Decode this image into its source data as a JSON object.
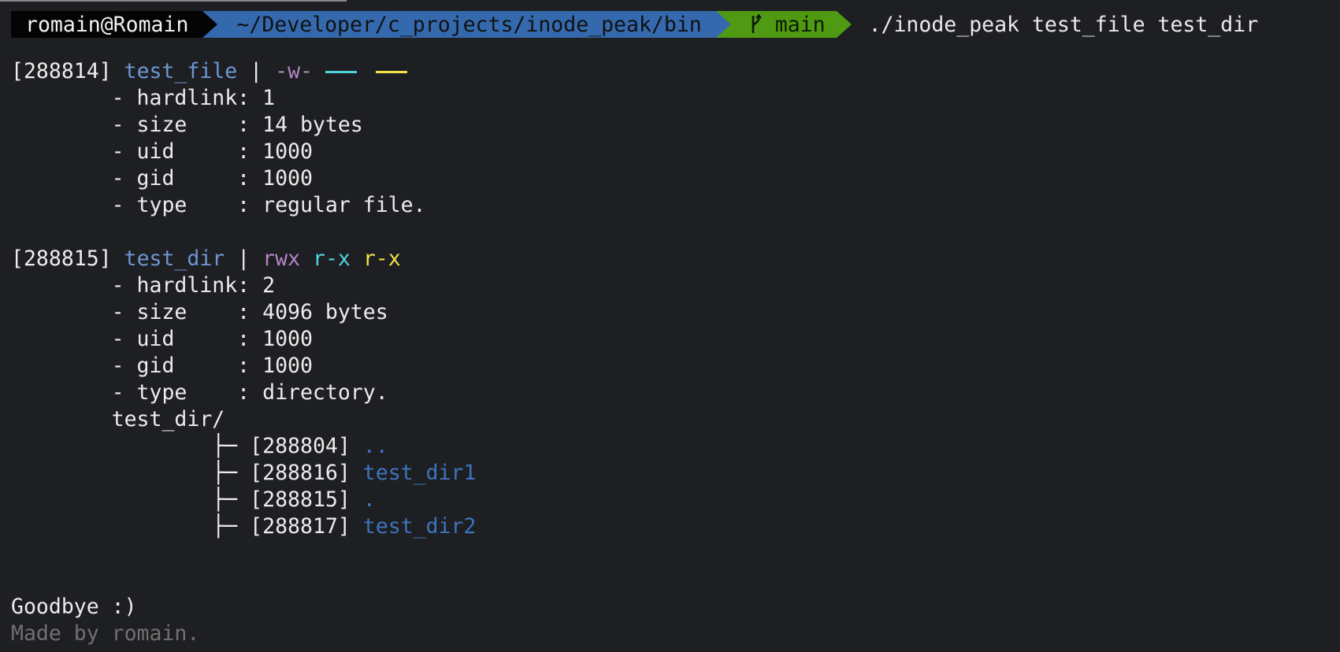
{
  "prompt": {
    "user": "romain@Romain",
    "path": "~/Developer/c_projects/inode_peak/bin",
    "branch": "main",
    "command": "./inode_peak test_file test_dir"
  },
  "file_entry": {
    "inode": "[288814]",
    "name": "test_file",
    "separator": "|",
    "perm_user": "-w-",
    "perm_group": "---",
    "perm_other": "---",
    "hardlink_label": "- hardlink:",
    "hardlink": "1",
    "size_label": "- size    :",
    "size": "14 bytes",
    "uid_label": "- uid     :",
    "uid": "1000",
    "gid_label": "- gid     :",
    "gid": "1000",
    "type_label": "- type    :",
    "type": "regular file."
  },
  "dir_entry": {
    "inode": "[288815]",
    "name": "test_dir",
    "separator": "|",
    "perm_user": "rwx",
    "perm_group": "r-x",
    "perm_other": "r-x",
    "hardlink_label": "- hardlink:",
    "hardlink": "2",
    "size_label": "- size    :",
    "size": "4096 bytes",
    "uid_label": "- uid     :",
    "uid": "1000",
    "gid_label": "- gid     :",
    "gid": "1000",
    "type_label": "- type    :",
    "type": "directory.",
    "listing_header": "test_dir/",
    "tree_glyph": "├─",
    "children": [
      {
        "inode": "[288804]",
        "name": ".."
      },
      {
        "inode": "[288816]",
        "name": "test_dir1"
      },
      {
        "inode": "[288815]",
        "name": "."
      },
      {
        "inode": "[288817]",
        "name": "test_dir2"
      }
    ]
  },
  "footer": {
    "goodbye": "Goodbye :)",
    "credit": "Made by romain."
  },
  "colors": {
    "background": "#1e1f22",
    "prompt_user_bg": "#040404",
    "prompt_path_bg": "#3569ae",
    "prompt_branch_bg": "#4f9a12",
    "name_blue": "#6d96d2",
    "perm_user": "#b585c6",
    "perm_group": "#4fd6da",
    "perm_other": "#f1e24a"
  },
  "icons": {
    "branch": "git-branch-icon"
  }
}
